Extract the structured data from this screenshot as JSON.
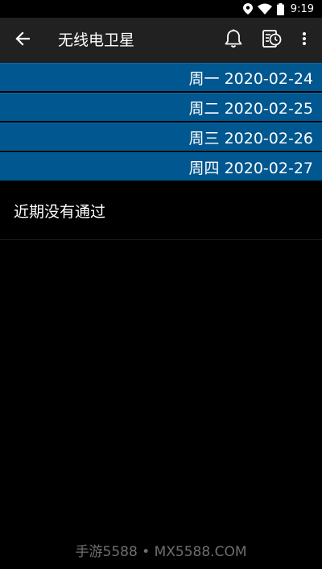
{
  "status_bar": {
    "time": "9:19",
    "icons": [
      "location-icon",
      "wifi-icon",
      "battery-icon"
    ]
  },
  "app_bar": {
    "title": "无线电卫星",
    "icons": [
      "back-arrow-icon",
      "bell-icon",
      "schedule-icon",
      "more-vert-icon"
    ]
  },
  "dates": [
    "周一 2020-02-24",
    "周二 2020-02-25",
    "周三 2020-02-26",
    "周四 2020-02-27"
  ],
  "empty_message": "近期没有通过",
  "watermark": "手游5588 • MX5588.COM",
  "colors": {
    "app_bar": "#212121",
    "date_row": "#01578f",
    "background": "#000000",
    "watermark": "#6f6f6f"
  }
}
